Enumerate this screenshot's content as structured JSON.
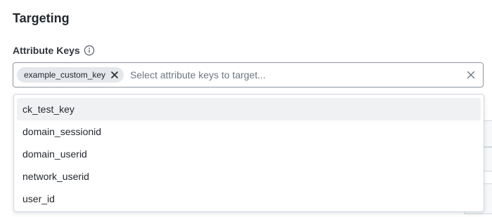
{
  "section": {
    "title": "Targeting"
  },
  "field": {
    "label": "Attribute Keys",
    "info_icon": "info-circle-icon"
  },
  "select": {
    "selected_chips": [
      {
        "label": "example_custom_key",
        "remove_icon": "close-icon"
      }
    ],
    "placeholder": "Select attribute keys to target...",
    "value": "",
    "clear_icon": "close-icon"
  },
  "dropdown": {
    "highlighted_index": 0,
    "options": [
      {
        "label": "ck_test_key"
      },
      {
        "label": "domain_sessionid"
      },
      {
        "label": "domain_userid"
      },
      {
        "label": "network_userid"
      },
      {
        "label": "user_id"
      }
    ]
  },
  "colors": {
    "chip_background": "#e4e7eb",
    "highlight_background": "#f0f1f3",
    "border": "#8c959f"
  }
}
